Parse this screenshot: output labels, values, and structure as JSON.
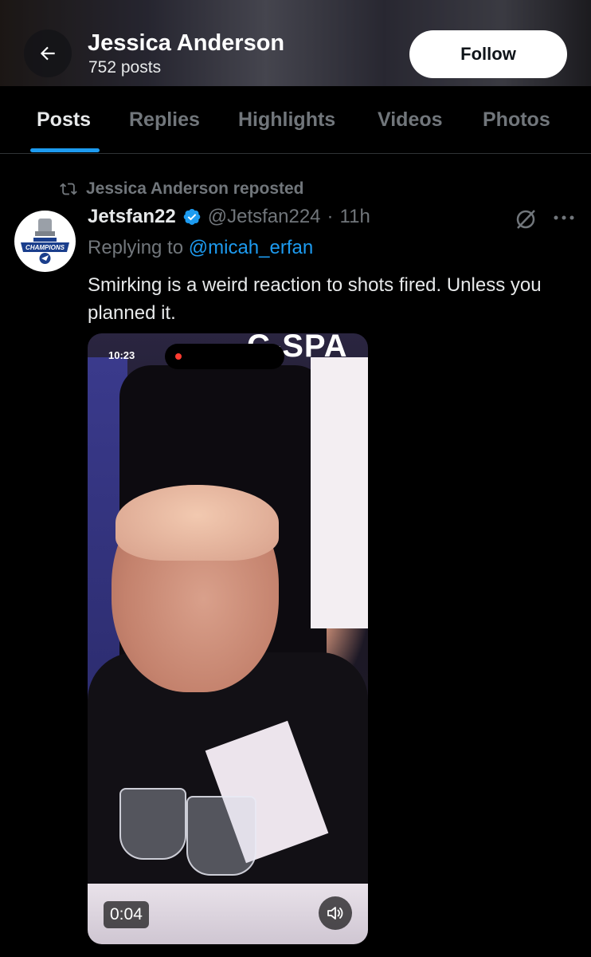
{
  "header": {
    "title": "Jessica Anderson",
    "posts_count": "752 posts",
    "follow_label": "Follow"
  },
  "tabs": [
    {
      "label": "Posts",
      "active": true
    },
    {
      "label": "Replies",
      "active": false
    },
    {
      "label": "Highlights",
      "active": false
    },
    {
      "label": "Videos",
      "active": false
    },
    {
      "label": "Photos",
      "active": false
    }
  ],
  "post": {
    "repost_label": "Jessica Anderson reposted",
    "author_name": "Jetsfan22",
    "verified": true,
    "handle": "@Jetsfan224",
    "separator": "·",
    "time": "11h",
    "replying_prefix": "Replying to",
    "replying_to": "@micah_erfan",
    "text": "Smirking is a weird reaction to shots fired. Unless you planned it.",
    "media": {
      "status_time": "10:23",
      "watermark": "C-SPA",
      "duration": "0:04"
    }
  },
  "colors": {
    "accent": "#1d9bf0",
    "background": "#000000",
    "secondary_text": "#71767b"
  }
}
